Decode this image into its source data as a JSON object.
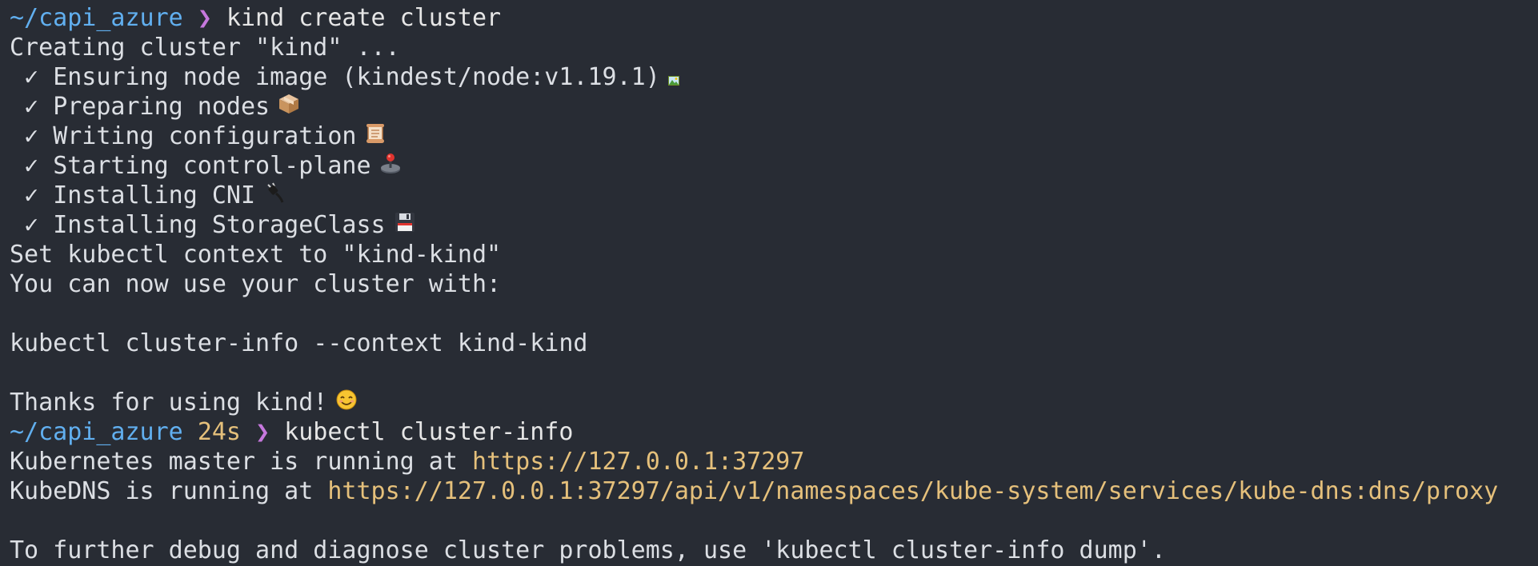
{
  "prompt": {
    "path": "~/capi_azure",
    "chevron": "❯",
    "duration": "24s"
  },
  "lines": {
    "cmd1": "kind create cluster",
    "creating": "Creating cluster \"kind\" ...",
    "check_mark": "✓",
    "steps": [
      "Ensuring node image (kindest/node:v1.19.1)",
      "Preparing nodes",
      "Writing configuration",
      "Starting control-plane",
      "Installing CNI",
      "Installing StorageClass"
    ],
    "set_context": "Set kubectl context to \"kind-kind\"",
    "use_cluster": "You can now use your cluster with:",
    "cluster_info_cmd": "kubectl cluster-info --context kind-kind",
    "thanks": "Thanks for using kind!",
    "cmd2": "kubectl cluster-info",
    "master_prefix": "Kubernetes master is running at ",
    "master_url": "https://127.0.0.1:37297",
    "dns_prefix": "KubeDNS is running at ",
    "dns_url": "https://127.0.0.1:37297/api/v1/namespaces/kube-system/services/kube-dns:dns/proxy",
    "debug": "To further debug and diagnose cluster problems, use 'kubectl cluster-info dump'."
  },
  "icons": [
    "image-icon",
    "package-box-icon",
    "scroll-icon",
    "joystick-icon",
    "plug-icon",
    "floppy-disk-icon",
    "smiling-face-icon"
  ],
  "colors": {
    "background": "#282c34",
    "text": "#dcdfe4",
    "path": "#61afef",
    "chevron": "#c678dd",
    "url": "#e5c07b"
  }
}
